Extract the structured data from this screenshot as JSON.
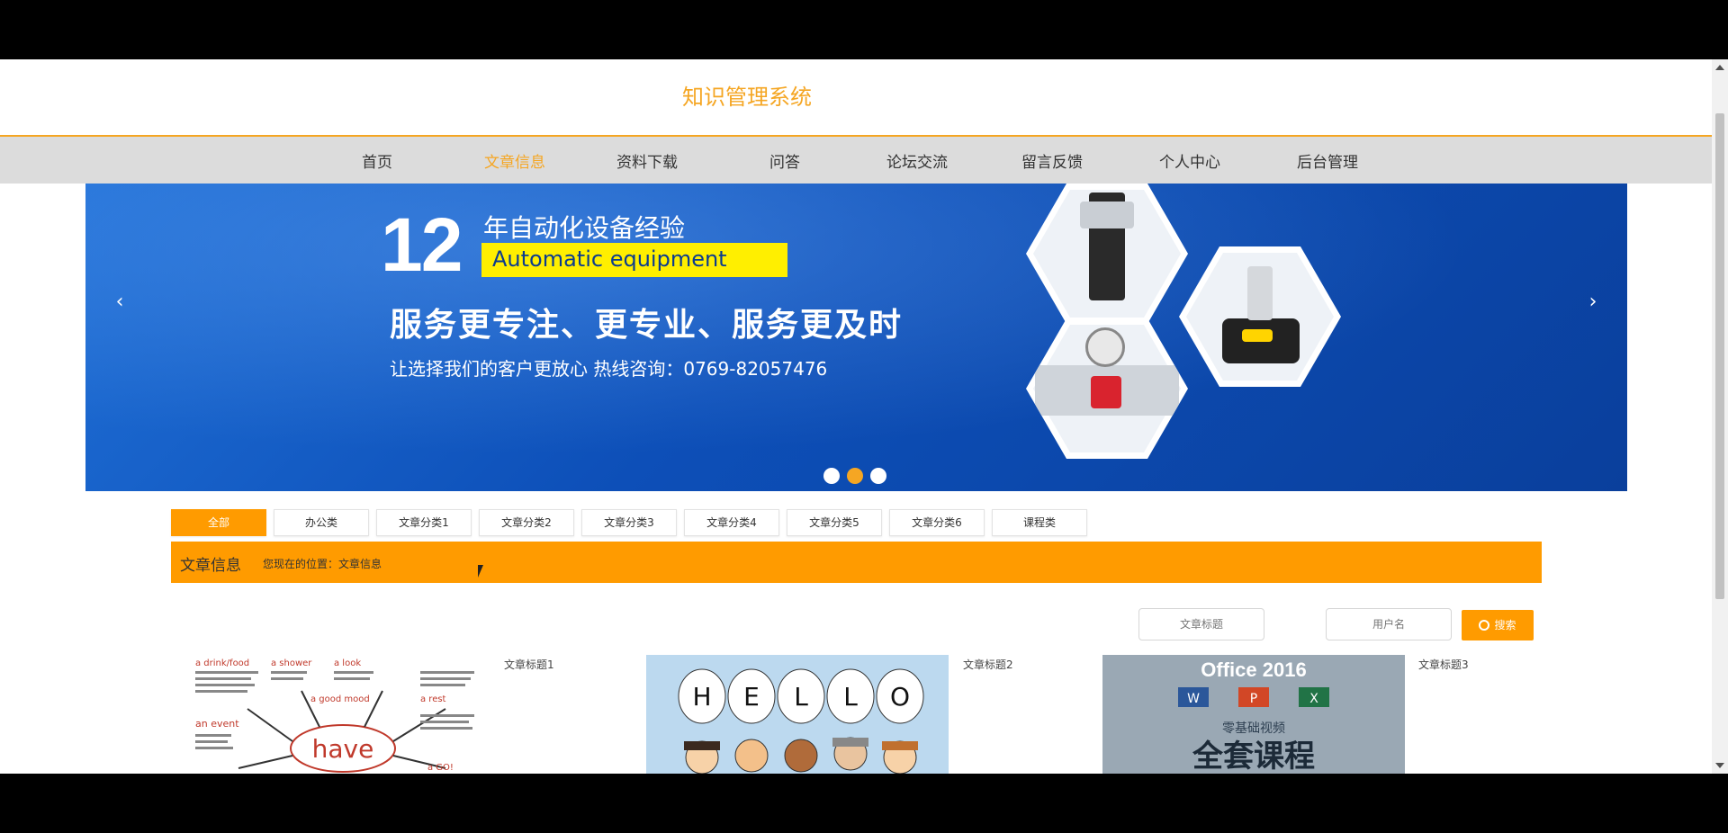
{
  "site": {
    "title": "知识管理系统"
  },
  "nav": {
    "items": [
      {
        "label": "首页"
      },
      {
        "label": "文章信息"
      },
      {
        "label": "资料下载"
      },
      {
        "label": "问答"
      },
      {
        "label": "论坛交流"
      },
      {
        "label": "留言反馈"
      },
      {
        "label": "个人中心"
      },
      {
        "label": "后台管理"
      }
    ],
    "active_index": 1
  },
  "banner": {
    "years_number": "12",
    "years_text": "年自动化设备经验",
    "english_tag": "Automatic equipment",
    "slogan": "服务更专注、更专业、服务更及时",
    "hotline": "让选择我们的客户更放心   热线咨询：0769-82057476",
    "prev_arrow": "‹",
    "next_arrow": "›",
    "slide_count": 3,
    "active_slide": 1
  },
  "categories": {
    "items": [
      "全部",
      "办公类",
      "文章分类1",
      "文章分类2",
      "文章分类3",
      "文章分类4",
      "文章分类5",
      "文章分类6",
      "课程类"
    ],
    "active_index": 0
  },
  "info_bar": {
    "title": "文章信息",
    "breadcrumb": "您现在的位置：文章信息"
  },
  "search": {
    "title_placeholder": "文章标题",
    "user_placeholder": "用户名",
    "button_label": "搜索"
  },
  "articles": [
    {
      "title": "文章标题1",
      "thumb_words": [
        "have",
        "a drink/food",
        "a shower",
        "a look",
        "an event",
        "a good mood",
        "a rest",
        "a GO!"
      ]
    },
    {
      "title": "文章标题2",
      "thumb_words": [
        "H",
        "E",
        "L",
        "L",
        "O"
      ]
    },
    {
      "title": "文章标题3",
      "thumb_words": [
        "Office 2016",
        "W",
        "P",
        "X",
        "零基础视频",
        "全套课程"
      ]
    }
  ],
  "colors": {
    "accent": "#ff9b00",
    "title_orange": "#f5a623",
    "nav_bg": "#dcdcdc",
    "banner_blue": "#0d4fb8"
  }
}
